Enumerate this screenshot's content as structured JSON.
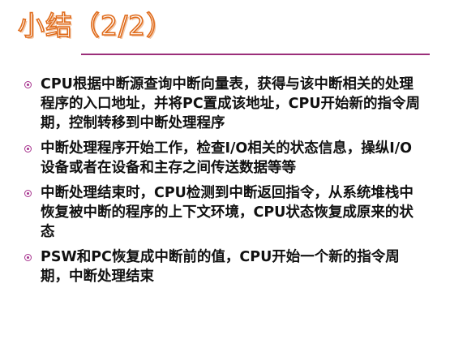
{
  "slide": {
    "title": "小结（2/2）",
    "bullets": [
      "CPU根据中断源查询中断向量表，获得与该中断相关的处理程序的入口地址，并将PC置成该地址，CPU开始新的指令周期，控制转移到中断处理程序",
      "中断处理程序开始工作，检查I/O相关的状态信息，操纵I/O设备或者在设备和主存之间传送数据等等",
      "中断处理结束时，CPU检测到中断返回指令，从系统堆栈中恢复被中断的程序的上下文环境，CPU状态恢复成原来的状态",
      "PSW和PC恢复成中断前的值，CPU开始一个新的指令周期，中断处理结束"
    ]
  },
  "colors": {
    "title_outline": "#e06c1c",
    "rule": "#9b2f7a",
    "bullet_marker": "#a7338e"
  },
  "icons": {
    "bullet": "circled-dot-bullet-icon"
  }
}
